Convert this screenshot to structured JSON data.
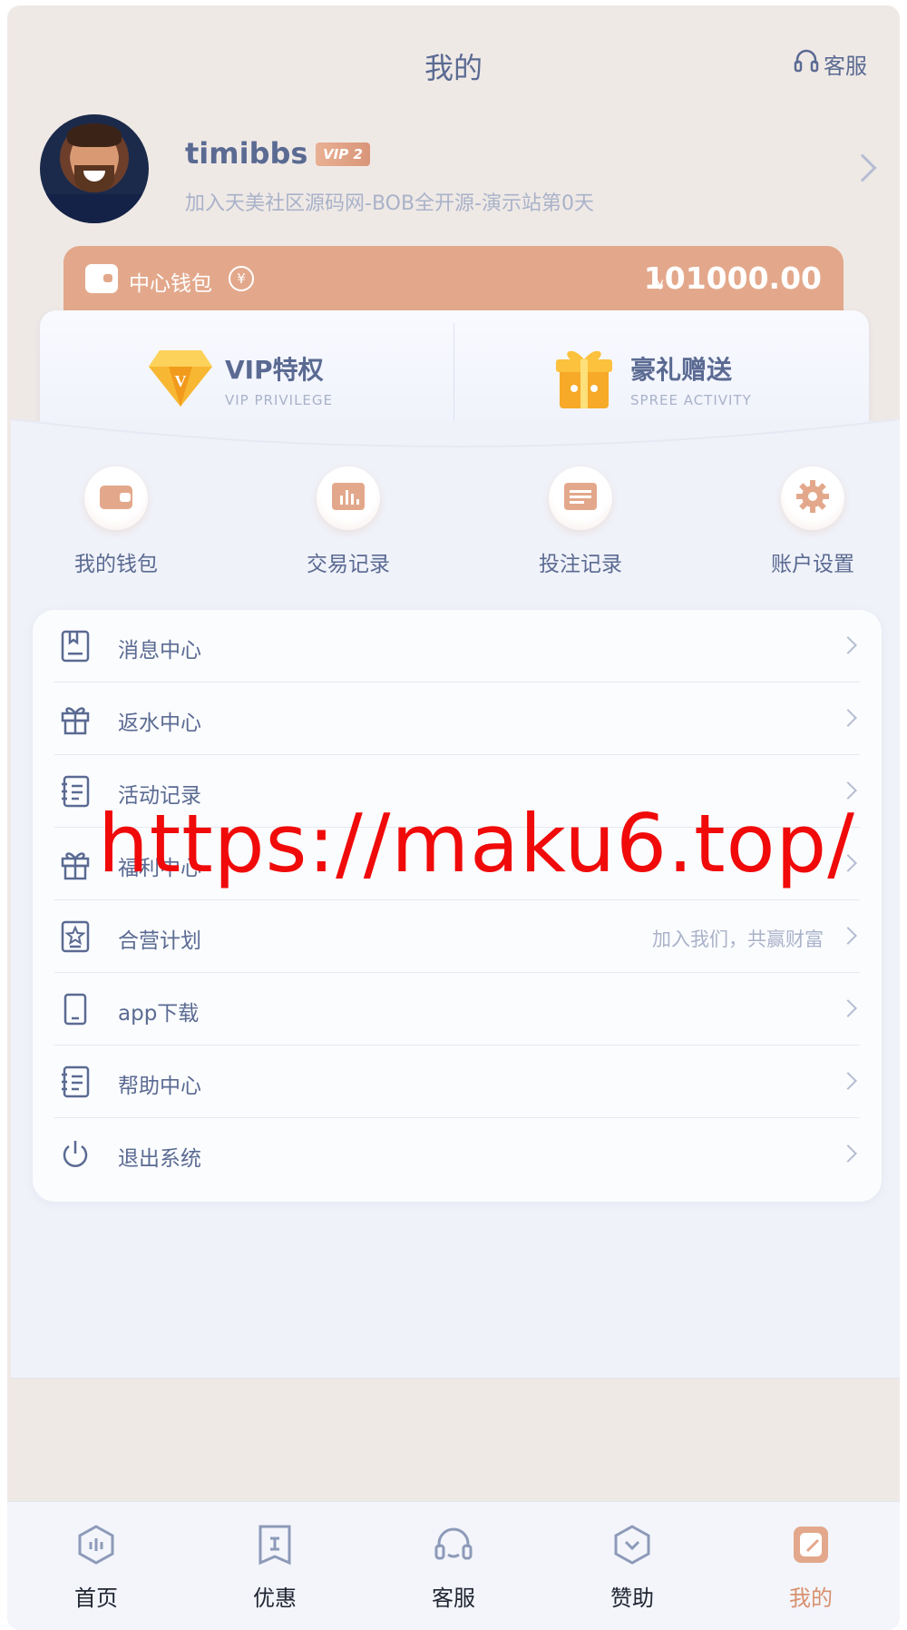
{
  "header": {
    "title": "我的",
    "cs_label": "客服"
  },
  "profile": {
    "username": "timibbs",
    "vip_badge": "VIP 2",
    "subtitle": "加入天美社区源码网-BOB全开源-演示站第0天"
  },
  "wallet": {
    "label": "中心钱包",
    "refresh_symbol": "¥",
    "currency_symbol": "¥",
    "balance": "101000.00"
  },
  "privileges": [
    {
      "title": "VIP特权",
      "subtitle": "VIP PRIVILEGE",
      "icon": "diamond-icon"
    },
    {
      "title": "豪礼赠送",
      "subtitle": "SPREE ACTIVITY",
      "icon": "gift-box-icon"
    }
  ],
  "quick_actions": [
    {
      "label": "我的钱包",
      "icon": "wallet-icon"
    },
    {
      "label": "交易记录",
      "icon": "chart-icon"
    },
    {
      "label": "投注记录",
      "icon": "document-icon"
    },
    {
      "label": "账户设置",
      "icon": "gear-icon"
    }
  ],
  "menu": [
    {
      "label": "消息中心",
      "extra": "",
      "icon": "message-book-icon"
    },
    {
      "label": "返水中心",
      "extra": "",
      "icon": "gift-icon"
    },
    {
      "label": "活动记录",
      "extra": "",
      "icon": "list-icon"
    },
    {
      "label": "福利中心",
      "extra": "",
      "icon": "gift-icon"
    },
    {
      "label": "合营计划",
      "extra": "加入我们，共赢财富",
      "icon": "star-badge-icon"
    },
    {
      "label": "app下载",
      "extra": "",
      "icon": "phone-icon"
    },
    {
      "label": "帮助中心",
      "extra": "",
      "icon": "list-icon"
    },
    {
      "label": "退出系统",
      "extra": "",
      "icon": "power-icon"
    }
  ],
  "watermark": "https://maku6.top/",
  "bottom_nav": [
    {
      "label": "首页",
      "icon": "home-icon",
      "active": false
    },
    {
      "label": "优惠",
      "icon": "coupon-icon",
      "active": false
    },
    {
      "label": "客服",
      "icon": "headset-icon",
      "active": false
    },
    {
      "label": "赞助",
      "icon": "sponsor-icon",
      "active": false
    },
    {
      "label": "我的",
      "icon": "profile-icon",
      "active": true
    }
  ],
  "colors": {
    "accent": "#e3a88b",
    "text": "#5a6a92",
    "muted": "#a9b2c9",
    "active_nav": "#d9906f",
    "watermark": "#f00a0a"
  }
}
